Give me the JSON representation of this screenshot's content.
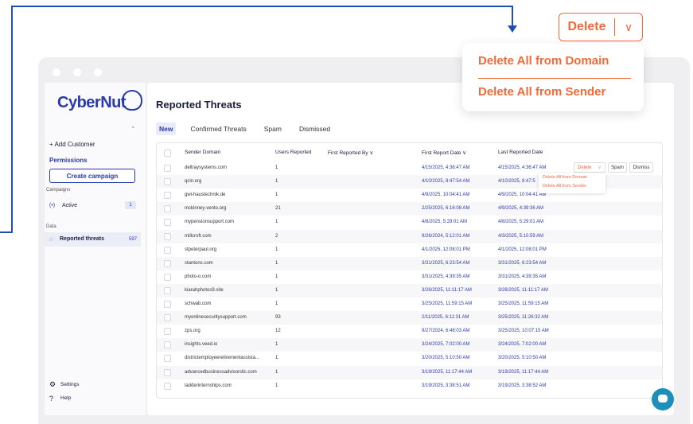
{
  "callout": {
    "delete_label": "Delete",
    "delete_all_domain": "Delete All from Domain",
    "delete_all_sender": "Delete All from Sender"
  },
  "sidebar": {
    "logo": "CyberNut",
    "add_customer": "+ Add Customer",
    "permissions": "Permissions",
    "create_campaign": "Create campaign",
    "campaigns_section": "Campaigns",
    "active_label": "Active",
    "active_count": "1",
    "data_section": "Data",
    "reported_threats_label": "Reported threats",
    "reported_threats_count": "597",
    "settings": "Settings",
    "help": "Help"
  },
  "main": {
    "title": "Reported Threats",
    "tabs": [
      "New",
      "Confirmed Threats",
      "Spam",
      "Dismissed"
    ]
  },
  "table": {
    "headers": [
      "Sender Domain",
      "Users Reported",
      "First Reported By ∨",
      "First Report Date ∨",
      "Last Reported Date"
    ],
    "rows": [
      [
        "deltraysystems.com",
        "1",
        "4/15/2025, 4:36:47 AM",
        "4/15/2025, 4:36:47 AM"
      ],
      [
        "qcin.org",
        "1",
        "4/10/2025, 8:47:54 AM",
        "4/10/2025, 8:47:5"
      ],
      [
        "gwi-haustechnik.de",
        "1",
        "4/9/2025, 10:04:41 AM",
        "4/9/2025, 10:04:41 AM"
      ],
      [
        "mckinney-vento.org",
        "21",
        "2/25/2025, 6:16:08 AM",
        "4/9/2025, 4:39:36 AM"
      ],
      [
        "mypensionsupport.com",
        "1",
        "4/8/2025, 5:29:01 AM",
        "4/8/2025, 5:29:01 AM"
      ],
      [
        "millcroft.com",
        "2",
        "9/26/2024, 5:12:01 AM",
        "4/3/2025, 5:10:59 AM"
      ],
      [
        "stpeterpaul.org",
        "1",
        "4/1/2025, 12:08:01 PM",
        "4/1/2025, 12:08:01 PM"
      ],
      [
        "stantons.com",
        "1",
        "3/31/2025, 6:23:54 AM",
        "3/31/2025, 6:23:54 AM"
      ],
      [
        "photo-o.com",
        "1",
        "3/31/2025, 4:39:35 AM",
        "3/31/2025, 4:39:35 AM"
      ],
      [
        "kiarahphotos9.site",
        "1",
        "3/26/2025, 11:11:17 AM",
        "3/26/2025, 11:11:17 AM"
      ],
      [
        "schwab.com",
        "1",
        "3/25/2025, 11:59:15 AM",
        "3/25/2025, 11:59:15 AM"
      ],
      [
        "myonlinesecuritysupport.com",
        "93",
        "2/11/2025, 6:11:31 AM",
        "3/25/2025, 11:26:32 AM"
      ],
      [
        "zps.org",
        "12",
        "9/27/2024, 6:48:03 AM",
        "3/25/2025, 10:07:15 AM"
      ],
      [
        "insights.veed.io",
        "1",
        "3/24/2025, 7:02:00 AM",
        "3/24/2025, 7:02:00 AM"
      ],
      [
        "districtemployeeretirementassista...",
        "1",
        "3/20/2025, 5:10:50 AM",
        "3/20/2025, 5:10:50 AM"
      ],
      [
        "advancedbusinessadvisorsllc.com",
        "1",
        "3/19/2025, 11:17:44 AM",
        "3/19/2025, 11:17:44 AM"
      ],
      [
        "ladderinternships.com",
        "1",
        "3/19/2025, 3:38:51 AM",
        "3/19/2025, 3:38:52 AM"
      ]
    ]
  },
  "row_actions": {
    "delete": "Delete",
    "spam": "Spam",
    "dismiss": "Dismiss",
    "menu_domain": "Delete All from Domain",
    "menu_sender": "Delete All from Sender"
  }
}
